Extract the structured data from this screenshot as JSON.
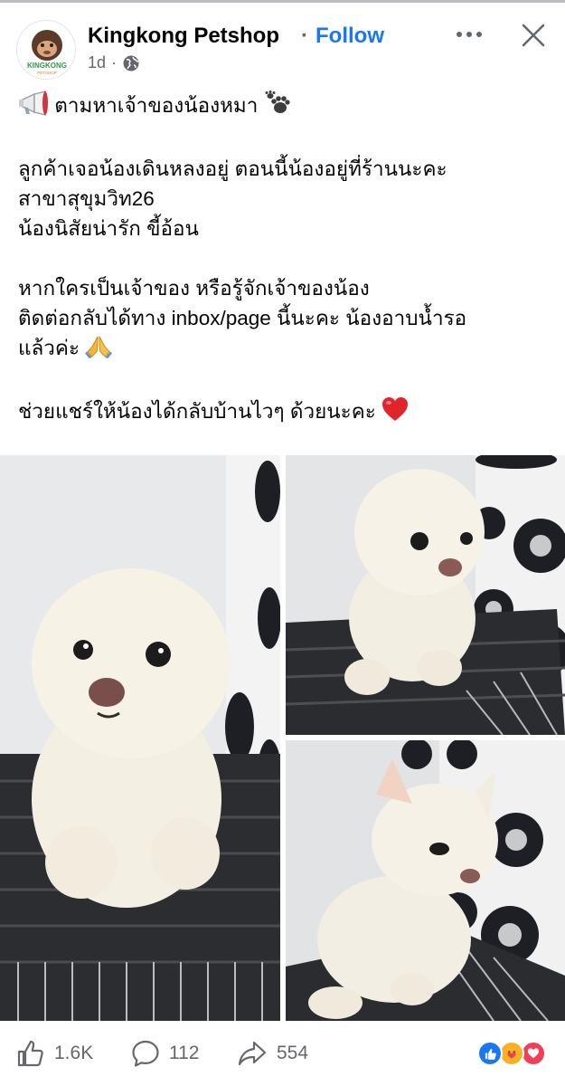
{
  "post": {
    "page_name": "Kingkong Petshop",
    "separator": "·",
    "follow_label": "Follow",
    "time": "1d",
    "meta_separator": "·",
    "privacy_icon": "globe-icon",
    "avatar_text": {
      "top": "KINGKONG",
      "bottom": "PETSHOP"
    }
  },
  "text": {
    "line1": "ตามหาเจ้าของน้องหมา",
    "line2": "ลูกค้าเจอน้องเดินหลงอยู่ ตอนนี้น้องอยู่ที่ร้านนะคะ",
    "line3": "สาขาสุขุมวิท26",
    "line4": "น้องนิสัยน่ารัก ขี้อ้อน",
    "line5": "หากใครเป็นเจ้าของ หรือรู้จักเจ้าของน้อง",
    "line6": "ติดต่อกลับได้ทาง inbox/page นี้นะคะ น้องอาบน้ำรอ",
    "line7": "แล้วค่ะ",
    "line8": "ช่วยแชร์ให้น้องได้กลับบ้านไวๆ ด้วยนะคะ"
  },
  "photos": [
    {
      "subject": "white Pomeranian puppy front view"
    },
    {
      "subject": "white Pomeranian puppy sitting"
    },
    {
      "subject": "white Pomeranian puppy side view"
    }
  ],
  "stats": {
    "likes": "1.6K",
    "comments": "112",
    "shares": "554",
    "reactions": [
      "like-icon",
      "care-icon",
      "love-icon"
    ]
  },
  "colors": {
    "follow": "#1877f2",
    "secondary_text": "#65676b",
    "like": "#1877f2",
    "love": "#f33e58",
    "care": "#f7b125"
  }
}
